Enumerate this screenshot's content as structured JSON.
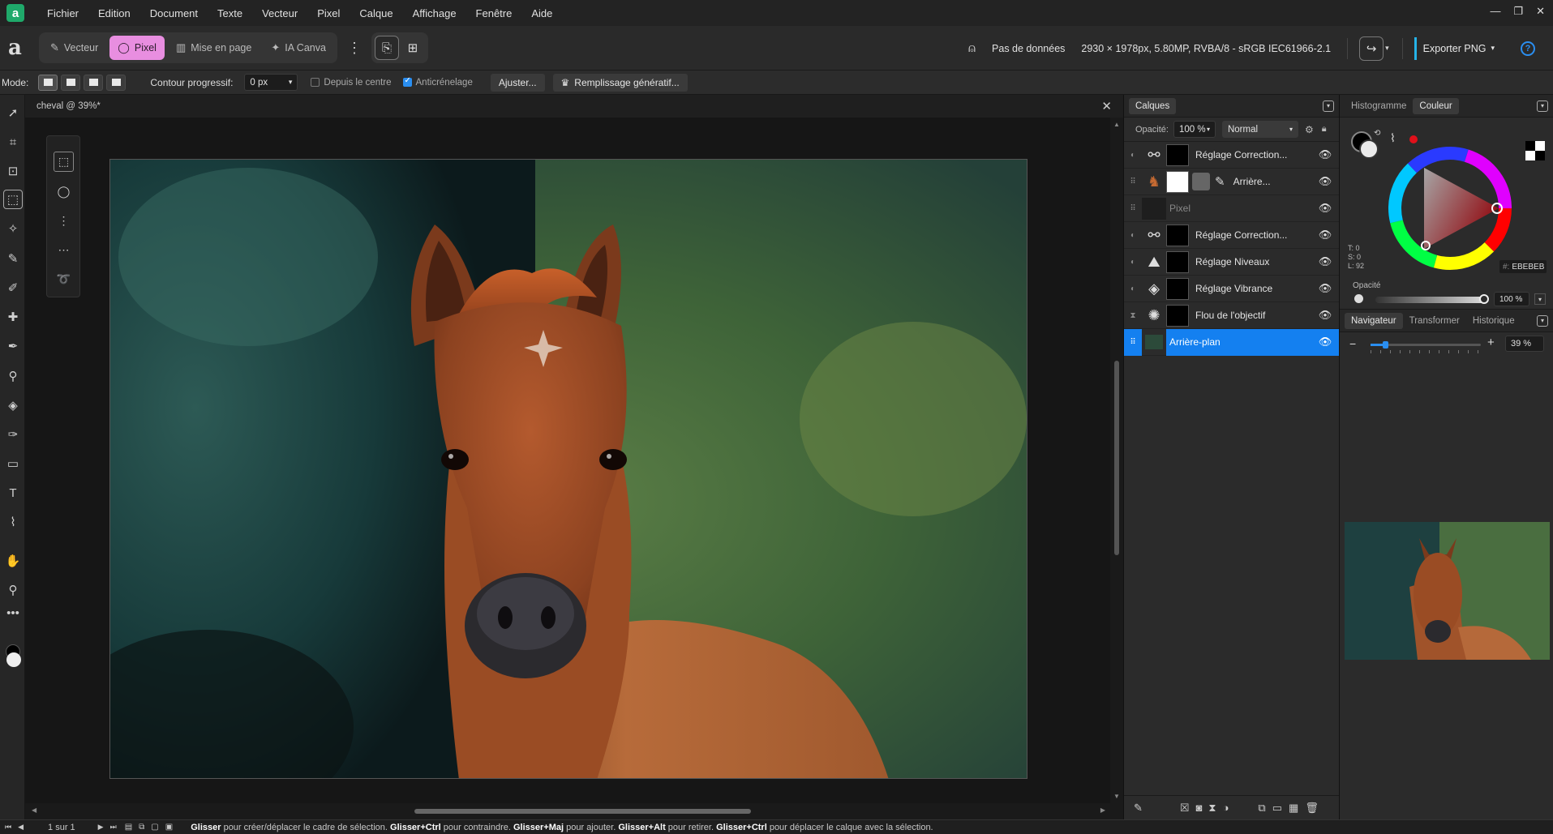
{
  "menubar": {
    "logo": "a",
    "items": [
      "Fichier",
      "Edition",
      "Document",
      "Texte",
      "Vecteur",
      "Pixel",
      "Calque",
      "Affichage",
      "Fenêtre",
      "Aide"
    ],
    "window_controls": [
      "—",
      "❐",
      "✕"
    ]
  },
  "toolbar": {
    "personas": [
      {
        "label": "Vecteur",
        "icon": "vector-persona-icon",
        "active": false
      },
      {
        "label": "Pixel",
        "icon": "pixel-persona-icon",
        "active": true
      },
      {
        "label": "Mise en page",
        "icon": "layout-persona-icon",
        "active": false
      },
      {
        "label": "IA Canva",
        "icon": "ai-sparkle-icon",
        "active": false
      }
    ],
    "no_data_label": "Pas de données",
    "document_info": "2930 × 1978px, 5.80MP, RVBA/8 - sRGB IEC61966-2.1",
    "export_label": "Exporter PNG",
    "help_label": "?"
  },
  "contextbar": {
    "mode_label": "Mode:",
    "feather_label": "Contour progressif:",
    "feather_value": "0 px",
    "from_center_label": "Depuis le centre",
    "from_center_checked": false,
    "antialias_label": "Anticrénelage",
    "antialias_checked": true,
    "adjust_label": "Ajuster...",
    "generative_fill_label": "Remplissage génératif..."
  },
  "document": {
    "tab_title": "cheval @ 39%*"
  },
  "layers": {
    "tabs": [
      "Calques"
    ],
    "opacity_label": "Opacité:",
    "opacity_value": "100 %",
    "blend_mode": "Normal",
    "rows": [
      {
        "name": "Réglage Correction...",
        "icon": "curves-adjustment-icon",
        "has_mask": true,
        "selected": false
      },
      {
        "name": "Arrière...",
        "icon": "horse-thumbnail",
        "has_mask": true,
        "selected": false
      },
      {
        "name": "Pixel",
        "icon": "pixel-layer-thumbnail",
        "has_mask": false,
        "selected": false,
        "dimmed": true
      },
      {
        "name": "Réglage Correction...",
        "icon": "curves-adjustment-icon",
        "has_mask": true,
        "selected": false
      },
      {
        "name": "Réglage Niveaux",
        "icon": "levels-adjustment-icon",
        "has_mask": true,
        "selected": false
      },
      {
        "name": "Réglage Vibrance",
        "icon": "vibrance-adjustment-icon",
        "has_mask": true,
        "selected": false
      },
      {
        "name": "Flou de l'objectif",
        "icon": "lens-blur-filter-icon",
        "has_mask": true,
        "selected": false
      },
      {
        "name": "Arrière-plan",
        "icon": "background-thumbnail",
        "has_mask": false,
        "selected": true
      }
    ]
  },
  "color_panel": {
    "tabs": [
      "Histogramme",
      "Couleur"
    ],
    "active_tab": "Couleur",
    "hex_label": "#:",
    "hex_value": "EBEBEB",
    "hsl_t": "T: 0",
    "hsl_s": "S: 0",
    "hsl_l": "L: 92",
    "opacity_label": "Opacité",
    "opacity_value": "100 %",
    "accent_color": "#e0101a"
  },
  "navigator": {
    "tabs": [
      "Navigateur",
      "Transformer",
      "Historique"
    ],
    "active_tab": "Navigateur",
    "zoom_value": "39 %",
    "zoom_level": 0.39
  },
  "statusbar": {
    "page_info": "1 sur 1",
    "hint": [
      {
        "b": "Glisser",
        "t": " pour créer/déplacer le cadre de sélection. "
      },
      {
        "b": "Glisser+Ctrl",
        "t": " pour contraindre. "
      },
      {
        "b": "Glisser+Maj",
        "t": " pour ajouter. "
      },
      {
        "b": "Glisser+Alt",
        "t": " pour retirer. "
      },
      {
        "b": "Glisser+Ctrl",
        "t": " pour déplacer le calque avec la sélection."
      }
    ]
  }
}
